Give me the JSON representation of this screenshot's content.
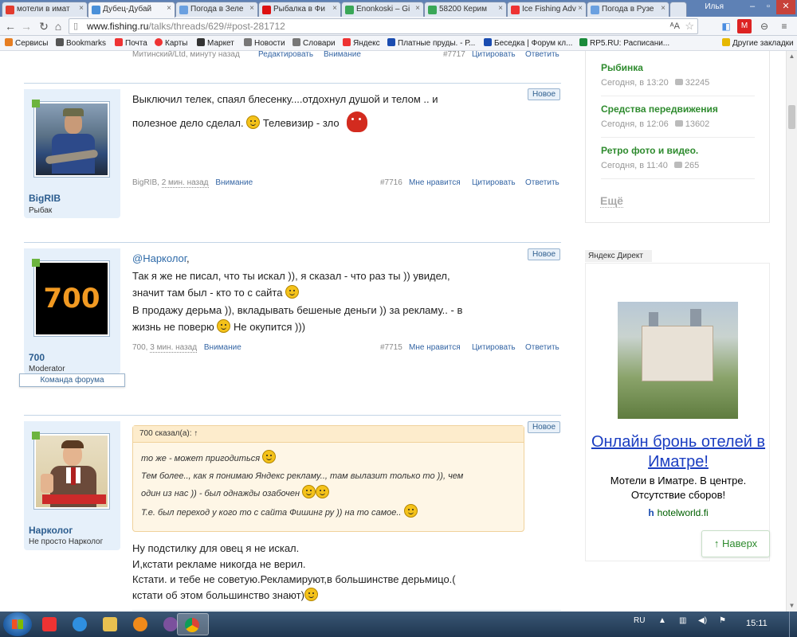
{
  "browser": {
    "tabs": [
      {
        "label": "мотели в имат",
        "color": "#e33b2e",
        "active": false
      },
      {
        "label": "Дубец-Дубай",
        "color": "#4a90d9",
        "active": true
      },
      {
        "label": "Погода в Зеле",
        "color": "#6aa0e0",
        "active": false
      },
      {
        "label": "Рыбалка в Фи",
        "color": "#d11",
        "active": false
      },
      {
        "label": "Enonkoski – Gi",
        "color": "#3aa757",
        "active": false
      },
      {
        "label": "58200 Керим",
        "color": "#3aa757",
        "active": false
      },
      {
        "label": "Ice Fishing Adv",
        "color": "#e33",
        "active": false
      },
      {
        "label": "Погода в Рузе",
        "color": "#6aa0e0",
        "active": false
      }
    ],
    "user_label": "Илья",
    "url_host": "www.fishing.ru",
    "url_path": "/talks/threads/629/#post-281712",
    "bookmarks": [
      {
        "label": "Сервисы",
        "icon": "apps-icon",
        "color": "#e67e22"
      },
      {
        "label": "Bookmarks",
        "icon": "star-icon",
        "color": "#555"
      },
      {
        "label": "Почта",
        "icon": "mail-icon",
        "color": "#e33"
      },
      {
        "label": "Карты",
        "icon": "map-pin-icon",
        "color": "#e33"
      },
      {
        "label": "Маркет",
        "icon": "market-icon",
        "color": "#333"
      },
      {
        "label": "Новости",
        "icon": "news-icon",
        "color": "#555"
      },
      {
        "label": "Словари",
        "icon": "book-icon",
        "color": "#555"
      },
      {
        "label": "Яндекс",
        "icon": "yandex-icon",
        "color": "#e33"
      },
      {
        "label": "Платные пруды. - Р...",
        "icon": "rf-icon",
        "color": "#1a4cb0"
      },
      {
        "label": "Беседка | Форум кл...",
        "icon": "rf-icon",
        "color": "#1a4cb0"
      },
      {
        "label": "RP5.RU: Расписани...",
        "icon": "rp5-icon",
        "color": "#1a8a3a"
      },
      {
        "label": "Другие закладки",
        "icon": "folder-icon",
        "color": "#e6b800"
      }
    ]
  },
  "prev_post": {
    "author_line": "Митинский/Ltd, минуту назад",
    "edit": "Редактировать",
    "attn": "Внимание",
    "num": "#7717",
    "quote": "Цитировать",
    "reply": "Ответить"
  },
  "posts": [
    {
      "user": "BigRIB",
      "role": "Рыбак",
      "new_label": "Новое",
      "lines": [
        "Выключил телек, спаял блесенку....отдохнул душой и телом .. и",
        "полезное дело сделал.",
        "Телевизир - зло"
      ],
      "meta_user": "BigRIB,",
      "meta_time": "2 мин. назад",
      "attn": "Внимание",
      "num": "#7716",
      "like": "Мне нравится",
      "quote": "Цитировать",
      "reply": "Ответить"
    },
    {
      "user": "700",
      "avatar_text": "700",
      "role": "Moderator",
      "team": "Команда форума",
      "new_label": "Новое",
      "mention": "@Нарколог",
      "lines": [
        "Так я же не писал, что ты искал )), я сказал - что раз ты )) увидел,",
        "значит там был - кто то с сайта",
        "В продажу дерьма )), вкладывать бешеные деньги )) за рекламу.. - в",
        "жизнь не поверю",
        "Не окупится )))"
      ],
      "meta_user": "700,",
      "meta_time": "3 мин. назад",
      "attn": "Внимание",
      "num": "#7715",
      "like": "Мне нравится",
      "quote": "Цитировать",
      "reply": "Ответить"
    },
    {
      "user": "Нарколог",
      "role": "Не просто Нарколог",
      "new_label": "Новое",
      "quote_head": "700 сказал(а): ↑",
      "quote_lines": [
        "то же - может пригодиться",
        "Тем более.., как я понимаю Яндекс рекламу.., там вылазит только то )), чем",
        "один из нас )) - был однажды озабочен",
        "Т.е. был переход у кого то с сайта Фишинг ру )) на то самое.."
      ],
      "lines": [
        "Ну подстилку для овец я не искал.",
        "И,кстати рекламе никогда не верил.",
        "Кстати. и тебе не советую.Рекламируют,в большинстве дерьмицо.(",
        "кстати об этом большинство знают)"
      ]
    }
  ],
  "sidebar": {
    "forums": [
      {
        "title": "Рыбинка",
        "time": "Сегодня, в 13:20",
        "count": "32245"
      },
      {
        "title": "Средства передвижения",
        "time": "Сегодня, в 12:06",
        "count": "13602"
      },
      {
        "title": "Ретро фото и видео.",
        "time": "Сегодня, в 11:40",
        "count": "265"
      }
    ],
    "more": "Ещё",
    "ad_label": "Яндекс Директ",
    "ad_title": "Онлайн бронь отелей в Иматре!",
    "ad_text": "Мотели в Иматре. В центре. Отсутствие сборов!",
    "ad_url": "hotelworld.fi",
    "back_top": "↑ Наверх"
  },
  "taskbar": {
    "lang": "RU",
    "time": "15:11"
  },
  "colors": {
    "accent_green": "#2e8b2e",
    "link_blue": "#3465a4",
    "quote_bg": "#fef6e6"
  }
}
